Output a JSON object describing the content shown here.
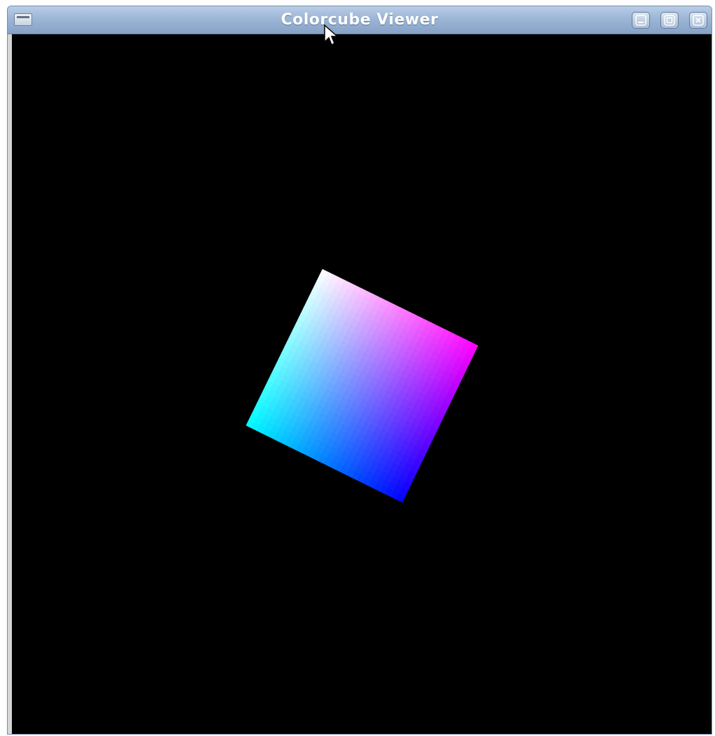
{
  "window": {
    "title": "Colorcube Viewer",
    "controls": {
      "minimize": "minimize",
      "maximize": "maximize",
      "close": "close"
    }
  },
  "scene": {
    "background": "#000000",
    "cube_face_colors": {
      "top_corner": "#ffffff",
      "right_corner": "#ff00ff",
      "bottom_corner": "#0000ff",
      "left_corner": "#00ffff"
    }
  },
  "icons": {
    "menu": "window-menu-icon",
    "minimize": "minimize-icon",
    "maximize": "maximize-icon",
    "close": "close-icon",
    "cursor": "mouse-pointer-icon"
  }
}
